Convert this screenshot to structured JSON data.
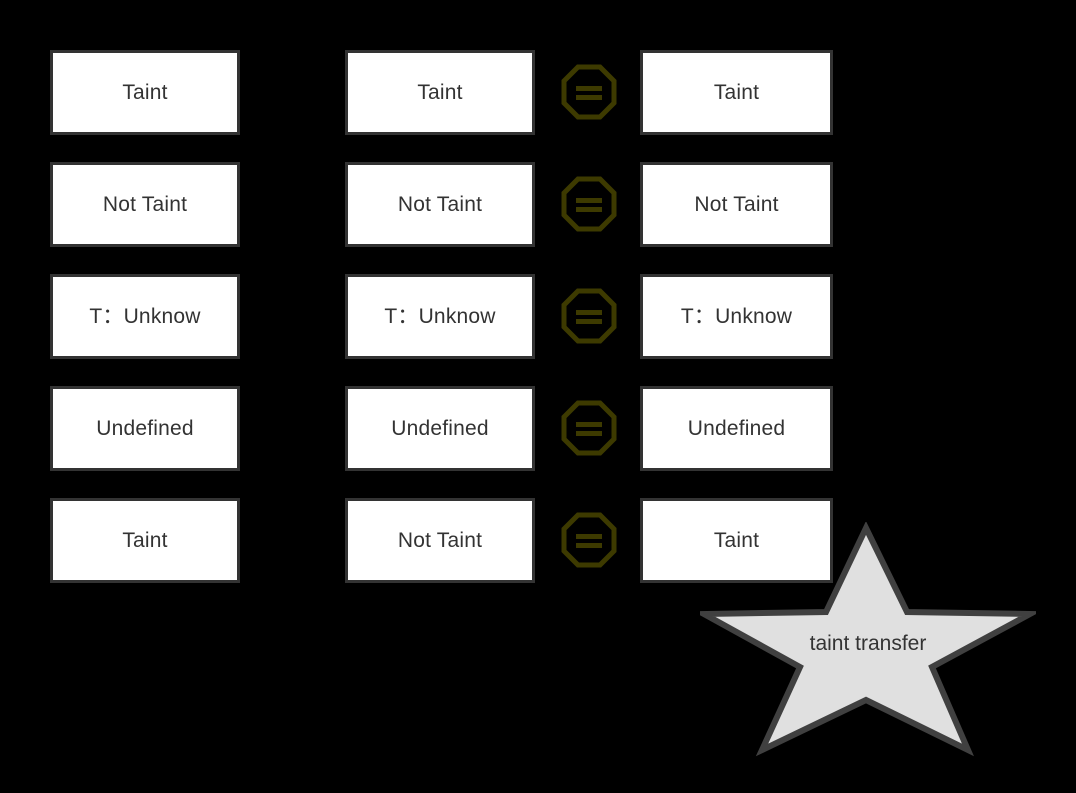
{
  "diagram": {
    "background_color": "#000000",
    "box_fill_color": "#FFFFFF",
    "box_border_color": "#333333",
    "text_color": "#333333",
    "icon_color": "#3D3A00",
    "star_fill_color": "#E0E0E0",
    "star_border_color": "#404040",
    "columns": 3,
    "rows": 5
  },
  "rows": [
    {
      "left": "Taint",
      "middle": "Taint",
      "operator": "equals",
      "right": "Taint"
    },
    {
      "left": "Not Taint",
      "middle": "Not Taint",
      "operator": "equals",
      "right": "Not Taint"
    },
    {
      "left": "T：Unknow",
      "middle": "T：Unknow",
      "operator": "equals",
      "right": "T：Unknow"
    },
    {
      "left": "Undefined",
      "middle": "Undefined",
      "operator": "equals",
      "right": "Undefined"
    },
    {
      "left": "Taint",
      "middle": "Not Taint",
      "operator": "equals",
      "right": "Taint"
    }
  ],
  "operator_icon": {
    "name": "octagon-equals-icon",
    "glyph": "equals"
  },
  "annotation": {
    "shape": "star",
    "label": "taint transfer"
  }
}
